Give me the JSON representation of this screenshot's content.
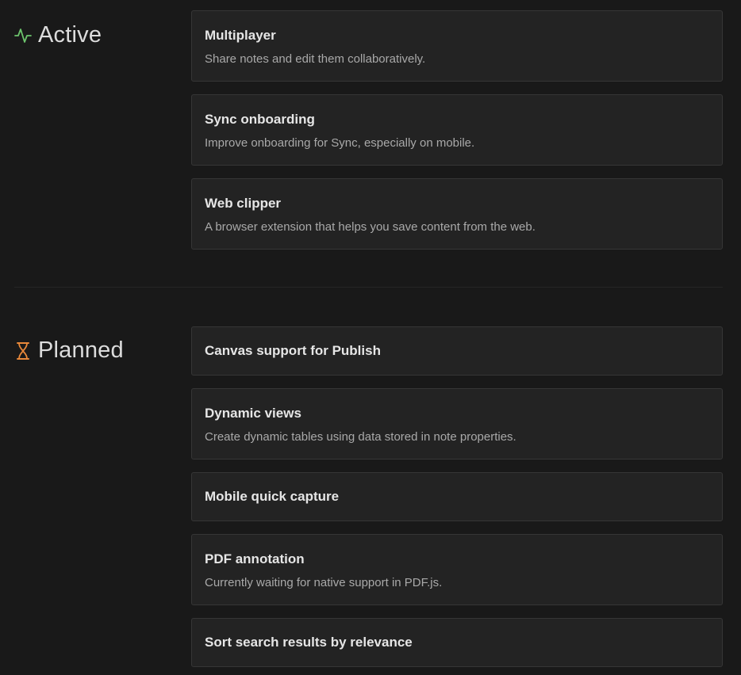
{
  "active": {
    "heading": "Active",
    "icon": "activity-icon",
    "icon_color": "#6cc46c",
    "items": [
      {
        "title": "Multiplayer",
        "description": "Share notes and edit them collaboratively."
      },
      {
        "title": "Sync onboarding",
        "description": "Improve onboarding for Sync, especially on mobile."
      },
      {
        "title": "Web clipper",
        "description": "A browser extension that helps you save content from the web."
      }
    ]
  },
  "planned": {
    "heading": "Planned",
    "icon": "hourglass-icon",
    "icon_color": "#e8883a",
    "items": [
      {
        "title": "Canvas support for Publish"
      },
      {
        "title": "Dynamic views",
        "description": "Create dynamic tables using data stored in note properties."
      },
      {
        "title": "Mobile quick capture"
      },
      {
        "title": "PDF annotation",
        "description": "Currently waiting for native support in PDF.js."
      },
      {
        "title": "Sort search results by relevance"
      }
    ]
  },
  "colors": {
    "background": "#191919",
    "card_background": "#232323",
    "card_border": "#363636"
  }
}
